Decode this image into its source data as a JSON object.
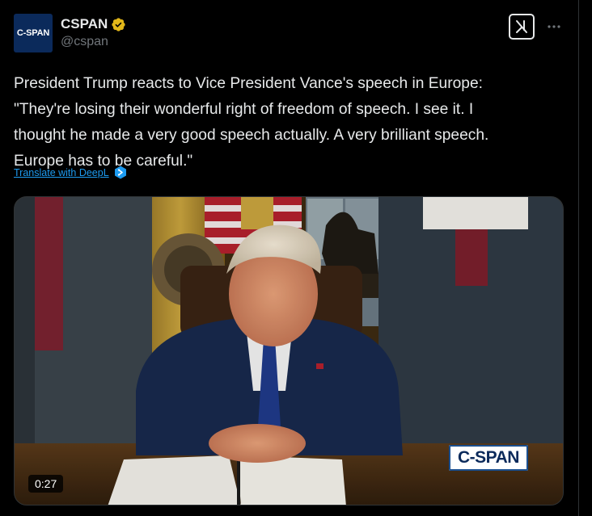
{
  "colors": {
    "background": "#000000",
    "text": "#e7e9ea",
    "secondary_text": "#71767b",
    "link": "#1d9bf0",
    "verified_gold": "#e2b719",
    "avatar_navy": "#0b2a5b"
  },
  "author": {
    "avatar_text": "C-SPAN",
    "display_name": "CSPAN",
    "handle": "@cspan",
    "verified_badge_icon": "verified-gold-badge-icon"
  },
  "header": {
    "grok_icon": "grok-icon",
    "more_icon": "more-horizontal-icon"
  },
  "tweet": {
    "text": "President Trump reacts to Vice President Vance's speech in Europe:\n\"They're losing their wonderful right of freedom of speech. I see it. I\nthought he made a very good speech actually. A very brilliant speech.\nEurope has to be careful.\"",
    "translate_label": "Translate with DeepL",
    "translate_icon": "deepl-icon"
  },
  "media": {
    "type": "video",
    "watermark": "C-SPAN",
    "duration": "0:27"
  }
}
